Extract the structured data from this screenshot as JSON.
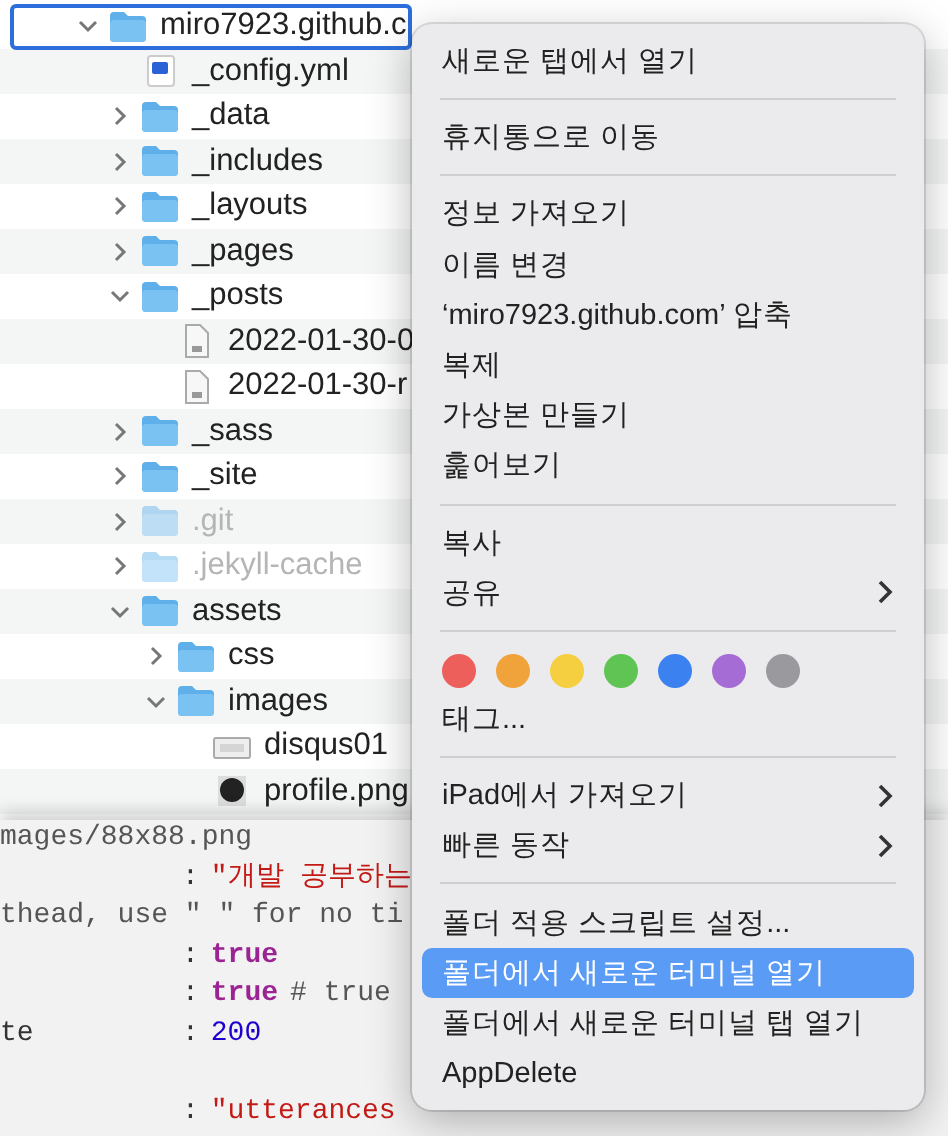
{
  "file_list": {
    "rows": [
      {
        "name": "miro7923.github.c",
        "kind": "folder",
        "expanded": true,
        "selected": true,
        "dimmed": false,
        "children": [
          {
            "name": "_config.yml",
            "kind": "yml",
            "selected": false,
            "dimmed": false
          },
          {
            "name": "_data",
            "kind": "folder",
            "expanded": false,
            "selected": false,
            "dimmed": false
          },
          {
            "name": "_includes",
            "kind": "folder",
            "expanded": false,
            "selected": false,
            "dimmed": false
          },
          {
            "name": "_layouts",
            "kind": "folder",
            "expanded": false,
            "selected": false,
            "dimmed": false
          },
          {
            "name": "_pages",
            "kind": "folder",
            "expanded": false,
            "selected": false,
            "dimmed": false
          },
          {
            "name": "_posts",
            "kind": "folder",
            "expanded": true,
            "selected": false,
            "dimmed": false,
            "children": [
              {
                "name": "2022-01-30-0",
                "kind": "document",
                "selected": false,
                "dimmed": false
              },
              {
                "name": "2022-01-30-r",
                "kind": "document",
                "selected": false,
                "dimmed": false
              }
            ]
          },
          {
            "name": "_sass",
            "kind": "folder",
            "expanded": false,
            "selected": false,
            "dimmed": false
          },
          {
            "name": "_site",
            "kind": "folder",
            "expanded": false,
            "selected": false,
            "dimmed": false
          },
          {
            "name": ".git",
            "kind": "folder",
            "expanded": false,
            "selected": false,
            "dimmed": true
          },
          {
            "name": ".jekyll-cache",
            "kind": "folder",
            "expanded": false,
            "selected": false,
            "dimmed": true
          },
          {
            "name": "assets",
            "kind": "folder",
            "expanded": true,
            "selected": false,
            "dimmed": false,
            "children": [
              {
                "name": "css",
                "kind": "folder",
                "expanded": false,
                "selected": false,
                "dimmed": false
              },
              {
                "name": "images",
                "kind": "folder",
                "expanded": true,
                "selected": false,
                "dimmed": false,
                "children": [
                  {
                    "name": "disqus01",
                    "kind": "image",
                    "selected": false,
                    "dimmed": false
                  },
                  {
                    "name": "profile.png",
                    "kind": "photo",
                    "selected": false,
                    "dimmed": false
                  }
                ]
              }
            ]
          }
        ]
      }
    ]
  },
  "code_editor": {
    "lines": [
      {
        "kind": "code",
        "segments": [
          {
            "text": "mages/88x88.png",
            "kind": "plain"
          }
        ]
      },
      {
        "kind": "code",
        "segments": [
          {
            "text": ":",
            "kind": "punct"
          },
          {
            "text": "\"개발 공부하는",
            "kind": "string"
          }
        ]
      },
      {
        "kind": "code",
        "segments": [
          {
            "text": "thead, use \" \" for no ti",
            "kind": "plain"
          }
        ]
      },
      {
        "kind": "code",
        "segments": [
          {
            "text": ":",
            "kind": "punct"
          },
          {
            "text": "true",
            "kind": "keyword"
          }
        ]
      },
      {
        "kind": "code",
        "segments": [
          {
            "text": ":",
            "kind": "punct"
          },
          {
            "text": "true",
            "kind": "keyword"
          },
          {
            "text": "# true",
            "kind": "plain"
          }
        ]
      },
      {
        "kind": "code",
        "segments": [
          {
            "text": "te",
            "kind": "key"
          },
          {
            "text": ":",
            "kind": "punct"
          },
          {
            "text": "200",
            "kind": "number"
          }
        ]
      },
      {
        "kind": "blank"
      },
      {
        "kind": "code",
        "segments": [
          {
            "text": ":",
            "kind": "punct"
          },
          {
            "text": "\"utterances",
            "kind": "string"
          }
        ]
      }
    ]
  },
  "context_menu": {
    "items": [
      {
        "kind": "item",
        "label": "새로운 탭에서 열기",
        "selected": false,
        "submenu": false
      },
      {
        "kind": "separator"
      },
      {
        "kind": "item",
        "label": "휴지통으로 이동",
        "selected": false,
        "submenu": false
      },
      {
        "kind": "separator"
      },
      {
        "kind": "item",
        "label": "정보 가져오기",
        "selected": false,
        "submenu": false
      },
      {
        "kind": "item",
        "label": "이름 변경",
        "selected": false,
        "submenu": false
      },
      {
        "kind": "item",
        "label": "‘miro7923.github.com’ 압축",
        "selected": false,
        "submenu": false
      },
      {
        "kind": "item",
        "label": "복제",
        "selected": false,
        "submenu": false
      },
      {
        "kind": "item",
        "label": "가상본 만들기",
        "selected": false,
        "submenu": false
      },
      {
        "kind": "item",
        "label": "훑어보기",
        "selected": false,
        "submenu": false
      },
      {
        "kind": "separator"
      },
      {
        "kind": "item",
        "label": "복사",
        "selected": false,
        "submenu": false
      },
      {
        "kind": "item",
        "label": "공유",
        "selected": false,
        "submenu": true
      },
      {
        "kind": "separator"
      },
      {
        "kind": "tags",
        "tags": [
          {
            "color": "#ec5f5a"
          },
          {
            "color": "#f0a23b"
          },
          {
            "color": "#f5cf3f"
          },
          {
            "color": "#5fc454"
          },
          {
            "color": "#3b82f0"
          },
          {
            "color": "#a66cd6"
          },
          {
            "color": "#9a9a9e"
          }
        ]
      },
      {
        "kind": "item",
        "label": "태그...",
        "selected": false,
        "submenu": false
      },
      {
        "kind": "separator"
      },
      {
        "kind": "item",
        "label": "iPad에서 가져오기",
        "selected": false,
        "submenu": true
      },
      {
        "kind": "item",
        "label": "빠른 동작",
        "selected": false,
        "submenu": true
      },
      {
        "kind": "separator"
      },
      {
        "kind": "item",
        "label": "폴더 적용 스크립트 설정...",
        "selected": false,
        "submenu": false
      },
      {
        "kind": "item",
        "label": "폴더에서 새로운 터미널 열기",
        "selected": true,
        "submenu": false
      },
      {
        "kind": "item",
        "label": "폴더에서 새로운 터미널 탭 열기",
        "selected": false,
        "submenu": false
      },
      {
        "kind": "item",
        "label": "AppDelete",
        "selected": false,
        "submenu": false
      }
    ]
  }
}
